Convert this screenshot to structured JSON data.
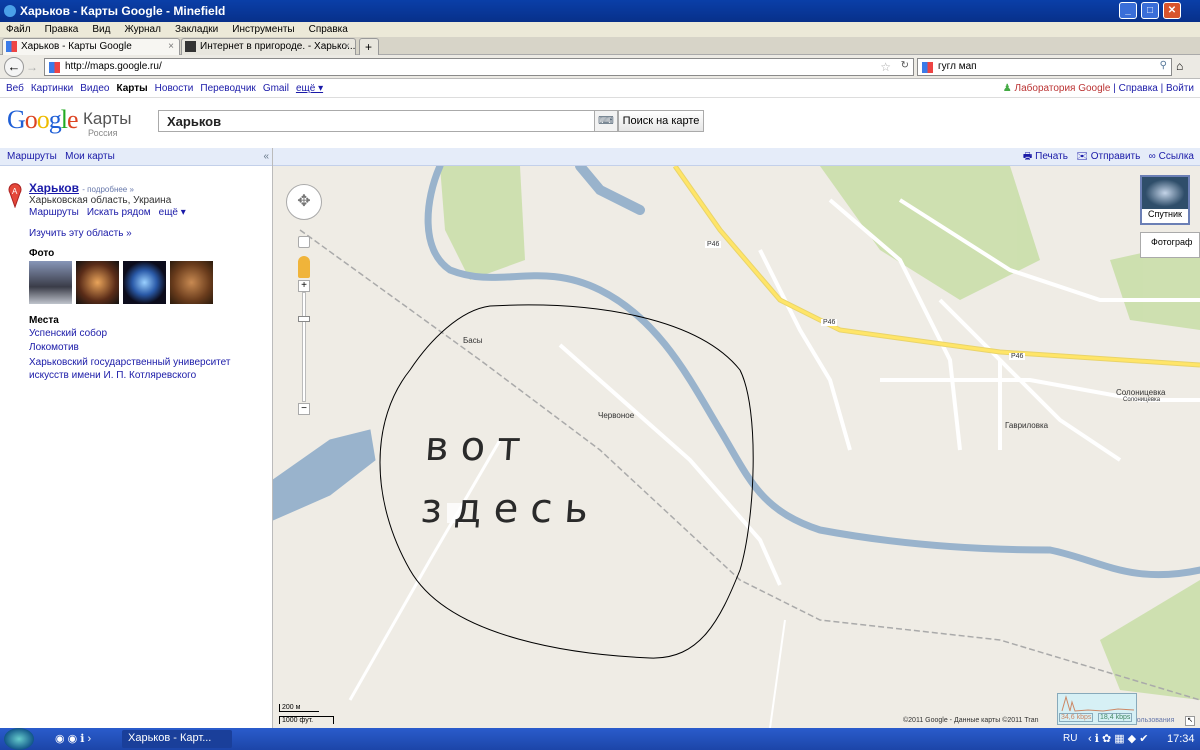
{
  "window": {
    "title": "Харьков - Карты Google - Minefield"
  },
  "menu": [
    "Файл",
    "Правка",
    "Вид",
    "Журнал",
    "Закладки",
    "Инструменты",
    "Справка"
  ],
  "tabs": [
    {
      "label": "Харьков - Карты Google"
    },
    {
      "label": "Интернет в пригороде. - Харько..."
    }
  ],
  "nav": {
    "url": "http://maps.google.ru/",
    "search_value": "гугл мап"
  },
  "gbar": {
    "left": [
      "Веб",
      "Картинки",
      "Видео",
      "Карты",
      "Новости",
      "Переводчик",
      "Gmail",
      "ещё ▾"
    ],
    "labs": "Лаборатория Google",
    "help": "Справка",
    "login": "Войти"
  },
  "header": {
    "logo": "Google",
    "product": "Карты",
    "region": "Россия",
    "search_value": "Харьков",
    "search_button": "Поиск на карте"
  },
  "sidebar": {
    "routes": "Маршруты",
    "my_maps": "Мои карты",
    "collapse": "«",
    "place": {
      "marker": "A",
      "name": "Харьков",
      "more": "- подробнее »",
      "region": "Харьковская область, Украина",
      "actions": [
        "Маршруты",
        "Искать рядом",
        "ещё ▾"
      ],
      "explore": "Изучить эту область »"
    },
    "photos_title": "Фото",
    "places_title": "Места",
    "places": [
      "Успенский собор",
      "Локомотив",
      "Харьковский государственный университет искусств имени И. П. Котляревского"
    ]
  },
  "maptools": {
    "print": "Печать",
    "send": "Отправить",
    "link": "Ссылка"
  },
  "map": {
    "satellite": "Спутник",
    "photos": "Фотограф",
    "labels": {
      "basy": "Басы",
      "chervonoe": "Червоное",
      "gavrilovka": "Гавриловка",
      "solon": "Солоницевка",
      "solon2": "Солоницевка",
      "r1": "Р46",
      "r2": "Р46",
      "r3": "Р46"
    },
    "scale_m": "200 м",
    "scale_ft": "1000 фут.",
    "copyright": "©2011 Google - Данные карты ©2011 Tran",
    "terms": "пользования",
    "handwriting": "вот здесь"
  },
  "netmon": {
    "down": "34,6 kbps",
    "up": "18,4 kbps"
  },
  "taskbar": {
    "task": "Харьков - Карт...",
    "lang": "RU",
    "clock": "17:34"
  },
  "colors": {
    "water": "#99b3cc",
    "road": "#ffe568",
    "land": "#efece5",
    "green": "#cadfaa"
  }
}
